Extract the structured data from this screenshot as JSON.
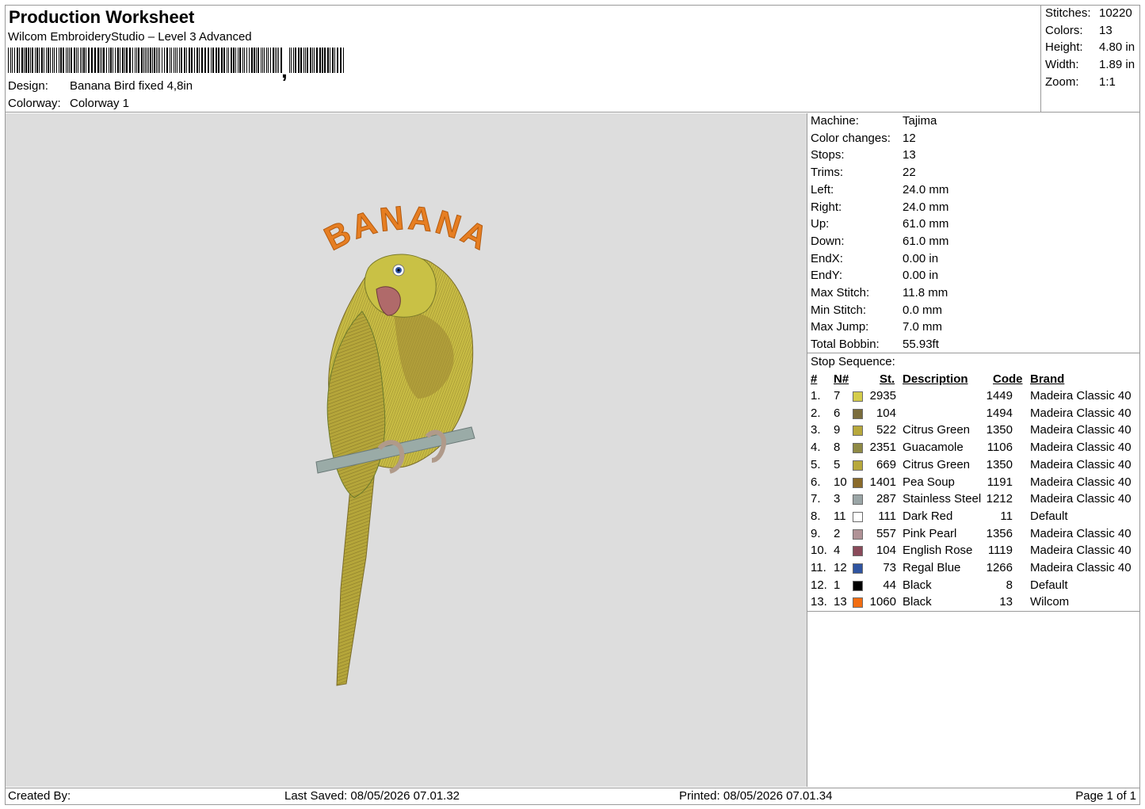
{
  "header": {
    "title": "Production Worksheet",
    "subtitle": "Wilcom EmbroideryStudio – Level 3 Advanced",
    "design_label": "Design:",
    "design_value": "Banana Bird fixed 4,8in",
    "colorway_label": "Colorway:",
    "colorway_value": "Colorway 1"
  },
  "stats": {
    "stitches_label": "Stitches:",
    "stitches_value": "10220",
    "colors_label": "Colors:",
    "colors_value": "13",
    "height_label": "Height:",
    "height_value": "4.80 in",
    "width_label": "Width:",
    "width_value": "1.89 in",
    "zoom_label": "Zoom:",
    "zoom_value": "1:1"
  },
  "design": {
    "text": "BANANA"
  },
  "machine_info": [
    {
      "label": "Machine:",
      "value": "Tajima"
    },
    {
      "label": "Color changes:",
      "value": "12"
    },
    {
      "label": "Stops:",
      "value": "13"
    },
    {
      "label": "Trims:",
      "value": "22"
    },
    {
      "label": "Left:",
      "value": "24.0 mm"
    },
    {
      "label": "Right:",
      "value": "24.0 mm"
    },
    {
      "label": "Up:",
      "value": "61.0 mm"
    },
    {
      "label": "Down:",
      "value": "61.0 mm"
    },
    {
      "label": "EndX:",
      "value": "0.00 in"
    },
    {
      "label": "EndY:",
      "value": "0.00 in"
    },
    {
      "label": "Max Stitch:",
      "value": "11.8 mm"
    },
    {
      "label": "Min Stitch:",
      "value": "0.0 mm"
    },
    {
      "label": "Max Jump:",
      "value": "7.0 mm"
    },
    {
      "label": "Total Bobbin:",
      "value": "55.93ft"
    }
  ],
  "stop_sequence": {
    "title": "Stop Sequence:",
    "headers": {
      "num": "#",
      "n": "N#",
      "st": "St.",
      "desc": "Description",
      "code": "Code",
      "brand": "Brand"
    },
    "rows": [
      {
        "num": "1.",
        "n": "7",
        "color": "#d4cc4a",
        "st": "2935",
        "desc": "",
        "code": "1449",
        "brand": "Madeira Classic 40"
      },
      {
        "num": "2.",
        "n": "6",
        "color": "#7a6c3c",
        "st": "104",
        "desc": "",
        "code": "1494",
        "brand": "Madeira Classic 40"
      },
      {
        "num": "3.",
        "n": "9",
        "color": "#b7a83c",
        "st": "522",
        "desc": "Citrus Green",
        "code": "1350",
        "brand": "Madeira Classic 40"
      },
      {
        "num": "4.",
        "n": "8",
        "color": "#8f8a45",
        "st": "2351",
        "desc": "Guacamole",
        "code": "1106",
        "brand": "Madeira Classic 40"
      },
      {
        "num": "5.",
        "n": "5",
        "color": "#b7a83c",
        "st": "669",
        "desc": "Citrus Green",
        "code": "1350",
        "brand": "Madeira Classic 40"
      },
      {
        "num": "6.",
        "n": "10",
        "color": "#8a6a2a",
        "st": "1401",
        "desc": "Pea Soup",
        "code": "1191",
        "brand": "Madeira Classic 40"
      },
      {
        "num": "7.",
        "n": "3",
        "color": "#9aa5a6",
        "st": "287",
        "desc": "Stainless Steel",
        "code": "1212",
        "brand": "Madeira Classic 40"
      },
      {
        "num": "8.",
        "n": "11",
        "color": "#ffffff",
        "st": "111",
        "desc": "Dark Red",
        "code": "11",
        "brand": "Default"
      },
      {
        "num": "9.",
        "n": "2",
        "color": "#b09296",
        "st": "557",
        "desc": "Pink Pearl",
        "code": "1356",
        "brand": "Madeira Classic 40"
      },
      {
        "num": "10.",
        "n": "4",
        "color": "#8a4a5a",
        "st": "104",
        "desc": "English Rose",
        "code": "1119",
        "brand": "Madeira Classic 40"
      },
      {
        "num": "11.",
        "n": "12",
        "color": "#2f54a0",
        "st": "73",
        "desc": "Regal Blue",
        "code": "1266",
        "brand": "Madeira Classic 40"
      },
      {
        "num": "12.",
        "n": "1",
        "color": "#000000",
        "st": "44",
        "desc": "Black",
        "code": "8",
        "brand": "Default"
      },
      {
        "num": "13.",
        "n": "13",
        "color": "#f26d12",
        "st": "1060",
        "desc": "Black",
        "code": "13",
        "brand": "Wilcom"
      }
    ]
  },
  "footer": {
    "created_by": "Created By:",
    "last_saved": "Last Saved: 08/05/2026 07.01.32",
    "printed": "Printed: 08/05/2026 07.01.34",
    "page": "Page 1 of 1"
  }
}
